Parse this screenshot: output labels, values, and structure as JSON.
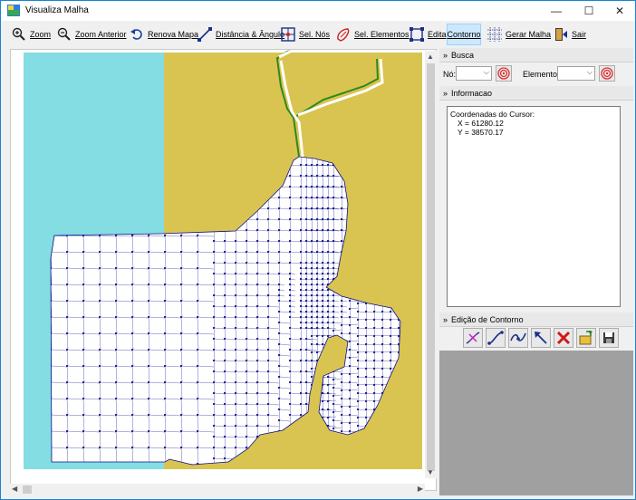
{
  "window": {
    "title": "Visualiza Malha"
  },
  "title_buttons": {
    "minimize": "—",
    "maximize": "☐",
    "close": "✕"
  },
  "toolbar": [
    {
      "id": "zoom",
      "label": "Zoom",
      "icon": "zoom-in-icon"
    },
    {
      "id": "zoom-anterior",
      "label": "Zoom Anterior",
      "icon": "zoom-out-icon"
    },
    {
      "id": "renova-mapa",
      "label": "Renova Mapa",
      "icon": "undo-arrow-icon"
    },
    {
      "id": "distancia-angulo",
      "label": "Distância & Ângulo",
      "icon": "measure-line-icon"
    },
    {
      "id": "sel-nos",
      "label": "Sel. Nós",
      "icon": "select-nodes-icon"
    },
    {
      "id": "sel-elementos",
      "label": "Sel. Elementos",
      "icon": "select-elements-icon"
    },
    {
      "id": "edita",
      "label": "Edita",
      "icon": "edit-polygon-icon"
    },
    {
      "id": "contorno",
      "label": "Contorno",
      "icon": "",
      "active": true
    },
    {
      "id": "gerar-malha",
      "label": "Gerar Malha",
      "icon": "mesh-grid-icon"
    },
    {
      "id": "sair",
      "label": "Sair",
      "icon": "exit-door-icon"
    }
  ],
  "busca": {
    "header": "Busca",
    "no_label": "Nó:",
    "no_value": "",
    "elemento_label": "Elemento:",
    "elemento_value": ""
  },
  "informacao": {
    "header": "Informacao",
    "cursor_title": "Coordenadas do Cursor:",
    "x_line": "X = 61280.12",
    "y_line": "Y = 38570.17"
  },
  "edicao": {
    "header": "Edição de Contorno",
    "buttons": [
      "add-node-curve-icon",
      "smooth-curve-icon",
      "join-curve-icon",
      "arrow-nodes-icon",
      "delete-x-icon",
      "open-file-icon",
      "save-file-icon"
    ]
  },
  "colors": {
    "water": "#83dde2",
    "land": "#d9c451",
    "mesh": "#0c0f8a",
    "boundary_green": "#2e8a1a",
    "active_tab": "#cce8ff"
  }
}
